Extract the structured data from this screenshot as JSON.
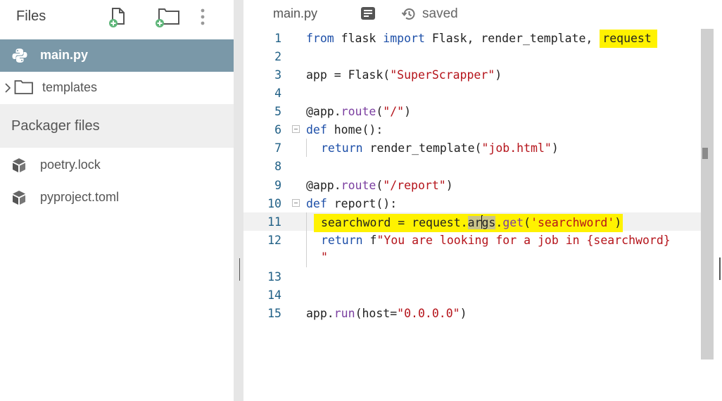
{
  "sidebar": {
    "title": "Files",
    "tree": [
      {
        "label": "main.py",
        "icon": "python-file-icon",
        "selected": true
      },
      {
        "label": "templates",
        "icon": "folder-icon",
        "selected": false
      }
    ],
    "packager_title": "Packager files",
    "packager_items": [
      {
        "label": "poetry.lock",
        "icon": "package-icon"
      },
      {
        "label": "pyproject.toml",
        "icon": "package-icon"
      }
    ]
  },
  "editor": {
    "tab_label": "main.py",
    "status_label": "saved",
    "active_line": 11
  },
  "code": {
    "line_numbers": [
      "1",
      "2",
      "3",
      "4",
      "5",
      "6",
      "7",
      "8",
      "9",
      "10",
      "11",
      "12",
      "13",
      "14",
      "15"
    ],
    "l1_from": "from",
    "l1_mid": " flask ",
    "l1_import": "import",
    "l1_rest": " Flask, render_template, ",
    "l1_request": "request",
    "l3_a": "app = Flask(",
    "l3_s": "\"SuperScrapper\"",
    "l3_b": ")",
    "l5_a": "@app.",
    "l5_fn": "route",
    "l5_b": "(",
    "l5_s": "\"/\"",
    "l5_c": ")",
    "l6_kw": "def",
    "l6_rest": " home():",
    "l7_kw": "return",
    "l7_a": " render_template(",
    "l7_s": "\"job.html\"",
    "l7_b": ")",
    "l9_a": "@app.",
    "l9_fn": "route",
    "l9_b": "(",
    "l9_s": "\"/report\"",
    "l9_c": ")",
    "l10_kw": "def",
    "l10_rest": " report():",
    "l11_a": "searchword = request.",
    "l11_ar": "ar",
    "l11_gs": "gs",
    "l11_dot": ".",
    "l11_get": "get",
    "l11_b": "(",
    "l11_s": "'searchword'",
    "l11_c": ")",
    "l12_kw": "return",
    "l12_f": " f",
    "l12_s": "\"You are looking for a job in {searchword}",
    "l12_wrap": "\"",
    "l15_a": "app.",
    "l15_fn": "run",
    "l15_b": "(host=",
    "l15_s": "\"0.0.0.0\"",
    "l15_c": ")"
  },
  "colors": {
    "selected_row": "#7a98a8",
    "keyword": "#1d4fa8",
    "string": "#b5141b",
    "function": "#7b3fa0",
    "highlight": "#fff200",
    "line_number": "#1f5f85"
  }
}
